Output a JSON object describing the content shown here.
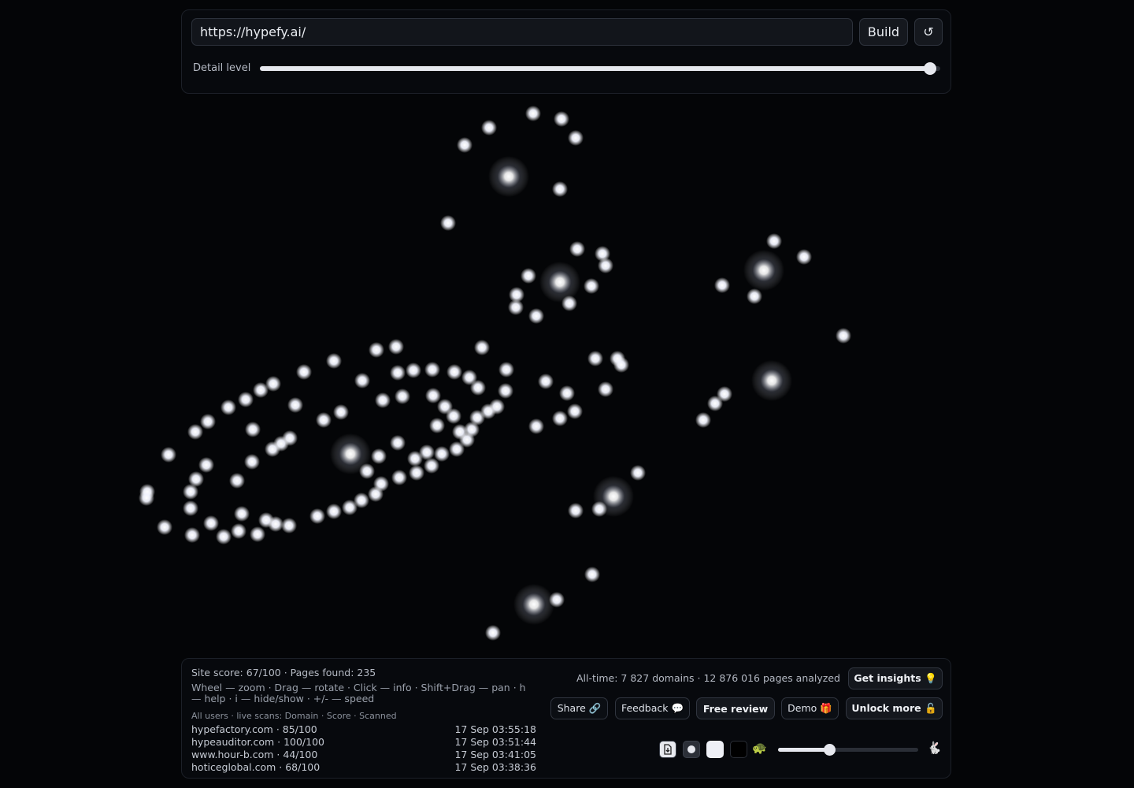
{
  "toolbar": {
    "url_value": "https://hypefy.ai/",
    "build_label": "Build",
    "reset_label": "↺",
    "detail_label": "Detail level",
    "detail_level": 0.985
  },
  "footer": {
    "stats": "Site score: 67/100 · Pages found: 235",
    "help": "Wheel — zoom · Drag — rotate · Click — info · Shift+Drag — pan · h — help · i — hide/show · +/- — speed",
    "scans_header": "All users · live scans: Domain · Score · Scanned",
    "scans": [
      {
        "site": "hypefactory.com · 85/100",
        "time": "17 Sep 03:55:18"
      },
      {
        "site": "hypeauditor.com · 100/100",
        "time": "17 Sep 03:51:44"
      },
      {
        "site": "www.hour-b.com · 44/100",
        "time": "17 Sep 03:41:05"
      },
      {
        "site": "hoticeglobal.com · 68/100",
        "time": "17 Sep 03:38:36"
      }
    ],
    "alltime": "All-time: 7 827 domains · 12 876 016 pages analyzed",
    "insights_label": "Get insights 💡",
    "share_label": "Share 🔗",
    "feedback_label": "Feedback 💬",
    "review_label": "Free review",
    "demo_label": "Demo 🎁",
    "unlock_label": "Unlock more 🔓",
    "speed_level": 0.37,
    "icons": {
      "download": "download-icon",
      "dot": "dot-icon",
      "turtle": "🐢",
      "rabbit": "🐇"
    }
  },
  "colors": {
    "background": "#040507",
    "node": "#ffffff",
    "panel": "#07090d"
  }
}
